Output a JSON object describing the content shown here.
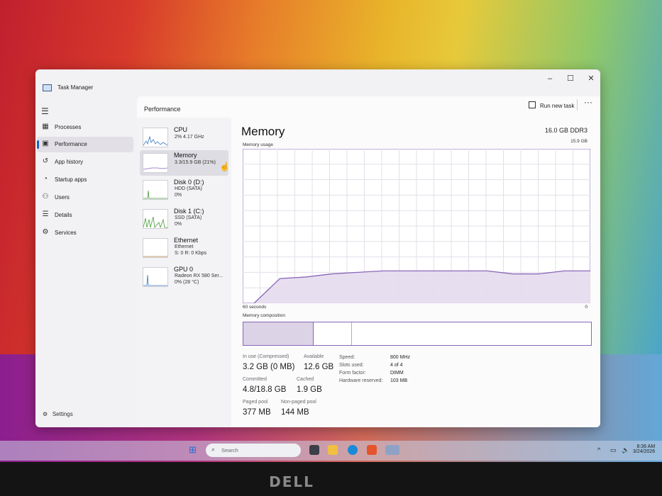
{
  "window": {
    "title": "Task Manager",
    "controls": {
      "minimize": "–",
      "maximize": "☐",
      "close": "✕"
    }
  },
  "nav": {
    "menu_icon": "hamburger-icon",
    "items": [
      {
        "label": "Processes",
        "icon": "processes-icon"
      },
      {
        "label": "Performance",
        "icon": "performance-icon",
        "active": true
      },
      {
        "label": "App history",
        "icon": "history-icon"
      },
      {
        "label": "Startup apps",
        "icon": "startup-icon"
      },
      {
        "label": "Users",
        "icon": "users-icon"
      },
      {
        "label": "Details",
        "icon": "details-icon"
      },
      {
        "label": "Services",
        "icon": "services-icon"
      }
    ],
    "settings_label": "Settings"
  },
  "header": {
    "title": "Performance",
    "run_task_label": "Run new task",
    "more_label": "···"
  },
  "devices": [
    {
      "name": "CPU",
      "lines": [
        "2% 4.17 GHz"
      ]
    },
    {
      "name": "Memory",
      "lines": [
        "3.3/15.9 GB (21%)"
      ],
      "active": true
    },
    {
      "name": "Disk 0 (D:)",
      "lines": [
        "HDD (SATA)",
        "0%"
      ]
    },
    {
      "name": "Disk 1 (C:)",
      "lines": [
        "SSD (SATA)",
        "0%"
      ]
    },
    {
      "name": "Ethernet",
      "lines": [
        "Ethernet",
        "S: 0 R: 0 Kbps"
      ]
    },
    {
      "name": "GPU 0",
      "lines": [
        "Radeon RX 580 Ser...",
        "0% (28 °C)"
      ]
    }
  ],
  "memory": {
    "title": "Memory",
    "total": "16.0 GB DDR3",
    "usage_label": "Memory usage",
    "usage_max": "15.9 GB",
    "time_left": "60 seconds",
    "time_right": "0",
    "composition_label": "Memory composition",
    "accent_color": "#8a66b8",
    "usage_series_fraction_of_max": [
      0.0,
      0.16,
      0.17,
      0.19,
      0.2,
      0.21,
      0.21,
      0.21,
      0.21,
      0.21,
      0.19,
      0.19,
      0.21,
      0.21
    ],
    "composition_fractions": {
      "in_use": 0.2,
      "modified": 0.11,
      "standby": 0.69
    },
    "stats": [
      {
        "label": "In use (Compressed)",
        "value": "3.2 GB (0 MB)"
      },
      {
        "label": "Available",
        "value": "12.6 GB"
      },
      {
        "label": "Committed",
        "value": "4.8/18.8 GB"
      },
      {
        "label": "Cached",
        "value": "1.9 GB"
      },
      {
        "label": "Paged pool",
        "value": "377 MB"
      },
      {
        "label": "Non-paged pool",
        "value": "144 MB"
      }
    ],
    "specs": [
      {
        "key": "Speed:",
        "value": "800 MHz"
      },
      {
        "key": "Slots used:",
        "value": "4 of 4"
      },
      {
        "key": "Form factor:",
        "value": "DIMM"
      },
      {
        "key": "Hardware reserved:",
        "value": "103 MB"
      }
    ]
  },
  "taskbar": {
    "search_placeholder": "Search",
    "time": "8:36 AM",
    "date": "3/24/2026"
  },
  "monitor_logo": "DELL"
}
